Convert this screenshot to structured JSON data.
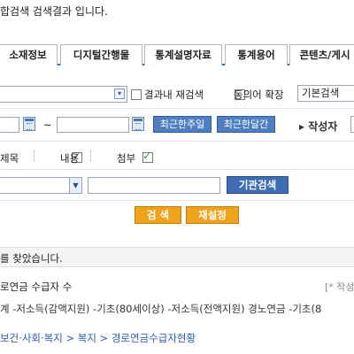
{
  "header": {
    "title": "합검색 검색결과 입니다."
  },
  "tabs": [
    {
      "label": "소재정보"
    },
    {
      "label": "디지털간행물"
    },
    {
      "label": "통계설명자료"
    },
    {
      "label": "통계용어"
    },
    {
      "label": "콘텐츠/게시"
    }
  ],
  "search": {
    "keyword_value": "",
    "option_result_within": "결과내 재검색",
    "option_synonym": "동의어 확장",
    "search_type_selected": "기본검색"
  },
  "period": {
    "from_value": "",
    "separator": "~",
    "to_value": "",
    "btn_recent_week": "최근한주일",
    "btn_recent_month": "최근한달간",
    "author_label": "▸ 작성자",
    "author_value": ""
  },
  "scope": {
    "title_label": "제목",
    "content_label": "내용",
    "attach_label": "첨부",
    "title_checked": false,
    "content_checked": true,
    "attach_checked": true
  },
  "institution": {
    "select_value": "",
    "input_value": "",
    "button_label": "기관검색"
  },
  "actions": {
    "search_label": "검 색",
    "reset_label": "재설정"
  },
  "result": {
    "message": "를 찾았습니다.",
    "item": {
      "title": "로연금 수급자 수",
      "author_tag": "[* 작성",
      "description": "계 -저소득(감액지원) -기초(80세이상) -저소득(전액지원) 경노연금 -기초(8",
      "path": "보건·사회·복지 > 복지 > 경로연금수급자현황"
    }
  },
  "colors": {
    "tab_border": "#3a6fb0",
    "blue_button": "#4f7fc0",
    "orange_button": "#f0a21a",
    "link": "#2a5db0"
  }
}
